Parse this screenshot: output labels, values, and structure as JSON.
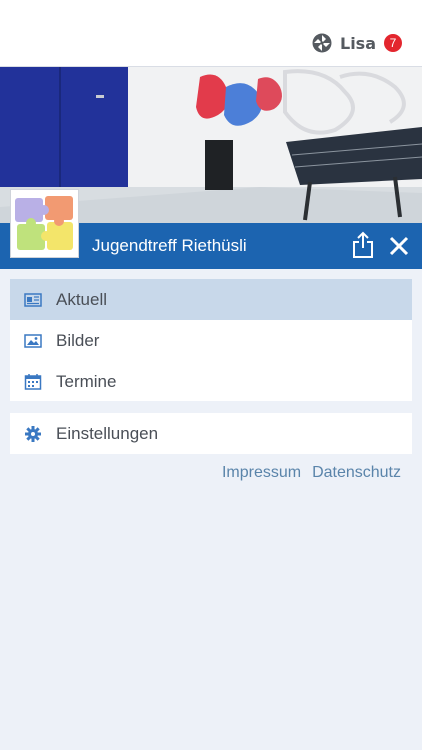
{
  "header": {
    "user_name": "Lisa",
    "badge_count": "7",
    "user_icon": "network-pinwheel-icon"
  },
  "hero": {
    "image_description": "youth club room with graffiti wall, blue door and foosball table"
  },
  "club": {
    "name": "Jugendtreff Riethüsli",
    "logo_icon": "puzzle-logo-icon",
    "share_icon": "share-icon",
    "close_icon": "close-icon"
  },
  "menu": {
    "items": [
      {
        "label": "Aktuell",
        "icon": "newspaper-icon",
        "active": true
      },
      {
        "label": "Bilder",
        "icon": "image-icon",
        "active": false
      },
      {
        "label": "Termine",
        "icon": "calendar-icon",
        "active": false
      }
    ],
    "settings": {
      "label": "Einstellungen",
      "icon": "gear-icon"
    }
  },
  "footer": {
    "impressum": "Impressum",
    "datenschutz": "Datenschutz"
  },
  "colors": {
    "accent": "#1c64b0",
    "badge": "#e3262e",
    "active_row": "#c8d8ea",
    "background": "#edf1f8",
    "link": "#5a84aa"
  }
}
